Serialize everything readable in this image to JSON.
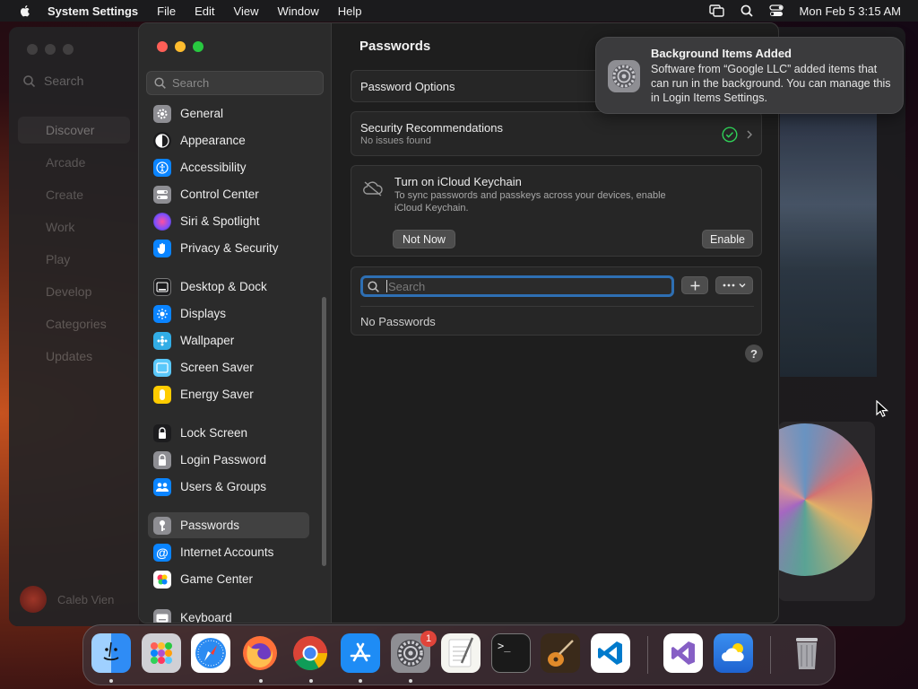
{
  "menubar": {
    "app_name": "System Settings",
    "menus": [
      "File",
      "Edit",
      "View",
      "Window",
      "Help"
    ],
    "clock": "Mon Feb 5  3:15 AM",
    "status_icons": [
      "screen-mirroring-icon",
      "spotlight-search-icon",
      "control-center-icon"
    ]
  },
  "background_app": {
    "search_placeholder": "Search",
    "nav": [
      "Discover",
      "Arcade",
      "Create",
      "Work",
      "Play",
      "Develop",
      "Categories",
      "Updates"
    ],
    "selected": "Discover",
    "user_name": "Caleb Vien"
  },
  "settings": {
    "search_placeholder": "Search",
    "sidebar": [
      {
        "label": "General",
        "icon": "gear-icon",
        "color": "#8e8e93"
      },
      {
        "label": "Appearance",
        "icon": "appearance-icon",
        "color": "#1c1c1e"
      },
      {
        "label": "Accessibility",
        "icon": "accessibility-icon",
        "color": "#0a84ff"
      },
      {
        "label": "Control Center",
        "icon": "control-center-icon",
        "color": "#8e8e93"
      },
      {
        "label": "Siri & Spotlight",
        "icon": "siri-icon",
        "color": "#b04fd0"
      },
      {
        "label": "Privacy & Security",
        "icon": "hand-icon",
        "color": "#0a84ff"
      },
      {
        "label": "Desktop & Dock",
        "icon": "desktop-dock-icon",
        "color": "#1c1c1e"
      },
      {
        "label": "Displays",
        "icon": "displays-icon",
        "color": "#0a84ff"
      },
      {
        "label": "Wallpaper",
        "icon": "wallpaper-icon",
        "color": "#32ade6"
      },
      {
        "label": "Screen Saver",
        "icon": "screen-saver-icon",
        "color": "#5ac8fa"
      },
      {
        "label": "Energy Saver",
        "icon": "energy-saver-icon",
        "color": "#ffcc00"
      },
      {
        "label": "Lock Screen",
        "icon": "lock-icon",
        "color": "#1c1c1e"
      },
      {
        "label": "Login Password",
        "icon": "login-password-icon",
        "color": "#8e8e93"
      },
      {
        "label": "Users & Groups",
        "icon": "users-icon",
        "color": "#0a84ff"
      },
      {
        "label": "Passwords",
        "icon": "key-icon",
        "color": "#8e8e93"
      },
      {
        "label": "Internet Accounts",
        "icon": "at-icon",
        "color": "#0a84ff"
      },
      {
        "label": "Game Center",
        "icon": "game-center-icon",
        "color": "#ffffff"
      },
      {
        "label": "Keyboard",
        "icon": "keyboard-icon",
        "color": "#8e8e93"
      }
    ],
    "selected": "Passwords",
    "page_title": "Passwords",
    "password_options": "Password Options",
    "security": {
      "title": "Security Recommendations",
      "subtitle": "No issues found"
    },
    "icloud": {
      "title": "Turn on iCloud Keychain",
      "description": "To sync passwords and passkeys across your devices, enable iCloud Keychain.",
      "not_now": "Not Now",
      "enable": "Enable"
    },
    "password_search_placeholder": "Search",
    "no_passwords": "No Passwords",
    "help": "?"
  },
  "notification": {
    "title": "Background Items Added",
    "body": "Software from “Google LLC” added items that can run in the background. You can manage this in Login Items Settings."
  },
  "dock": {
    "apps": [
      "Finder",
      "Launchpad",
      "Safari",
      "Firefox",
      "Google Chrome",
      "App Store",
      "System Settings",
      "TextEdit",
      "Terminal",
      "GarageBand",
      "Visual Studio Code",
      "Visual Studio",
      "Weather",
      "Trash"
    ],
    "badge": "1"
  }
}
